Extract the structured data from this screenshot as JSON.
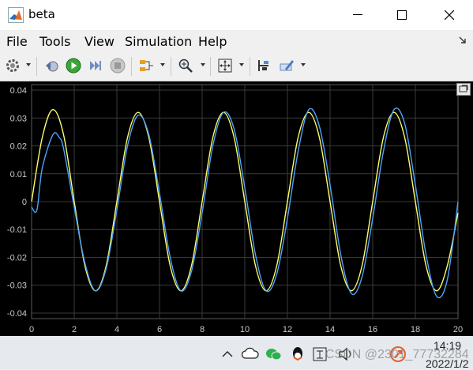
{
  "window": {
    "title": "beta"
  },
  "menu": [
    "File",
    "Tools",
    "View",
    "Simulation",
    "Help"
  ],
  "toolbar": {
    "icons": [
      "settings-gear-icon",
      "step-back-icon",
      "run-icon",
      "step-forward-icon",
      "stop-icon",
      "signal-select-icon",
      "zoom-icon",
      "fit-to-view-icon",
      "cursor-measure-icon",
      "highlight-pen-icon"
    ]
  },
  "colors": {
    "plot_bg": "#000000",
    "series_yellow": "#ffff66",
    "series_blue": "#4da3ff",
    "grid": "#3a3a3a",
    "tick_text": "#c8c8c8"
  },
  "chart_data": {
    "type": "line",
    "title": "",
    "xlabel": "",
    "ylabel": "",
    "xlim": [
      0,
      20
    ],
    "ylim": [
      -0.042,
      0.042
    ],
    "grid": true,
    "xticks": [
      "0",
      "2",
      "4",
      "6",
      "8",
      "10",
      "12",
      "14",
      "16",
      "18",
      "20"
    ],
    "yticks": [
      "0.04",
      "0.03",
      "0.02",
      "0.01",
      "0",
      "-0.01",
      "-0.02",
      "-0.03",
      "-0.04"
    ],
    "series": [
      {
        "color": "#ffff66",
        "x": [
          0,
          0.5,
          1,
          1.5,
          2,
          2.5,
          3,
          3.5,
          4,
          4.5,
          5,
          5.5,
          6,
          6.5,
          7,
          7.5,
          8,
          8.5,
          9,
          9.5,
          10,
          10.5,
          11,
          11.5,
          12,
          12.5,
          13,
          13.5,
          14,
          14.5,
          15,
          15.5,
          16,
          16.5,
          17,
          17.5,
          18,
          18.5,
          19,
          19.5,
          20
        ],
        "y": [
          0.0,
          0.023,
          0.033,
          0.024,
          0.0,
          -0.023,
          -0.032,
          -0.023,
          0.0,
          0.023,
          0.032,
          0.023,
          0.0,
          -0.023,
          -0.032,
          -0.023,
          0.0,
          0.023,
          0.032,
          0.023,
          0.0,
          -0.023,
          -0.032,
          -0.023,
          0.0,
          0.023,
          0.032,
          0.023,
          0.0,
          -0.023,
          -0.032,
          -0.023,
          0.0,
          0.023,
          0.032,
          0.023,
          0.0,
          -0.023,
          -0.032,
          -0.023,
          -0.004
        ]
      },
      {
        "color": "#4da3ff",
        "x": [
          0,
          0.25,
          0.5,
          1,
          1.3,
          1.5,
          2,
          2.5,
          3,
          3.5,
          4,
          4.5,
          5,
          5.5,
          6,
          6.5,
          7,
          7.5,
          8,
          8.5,
          9,
          9.5,
          10,
          10.5,
          11,
          11.5,
          12,
          12.5,
          13,
          13.5,
          14,
          14.5,
          15,
          15.5,
          16,
          16.5,
          17,
          17.5,
          18,
          18.5,
          19,
          19.5,
          20
        ],
        "y": [
          -0.002,
          -0.003,
          0.012,
          0.024,
          0.023,
          0.019,
          -0.002,
          -0.022,
          -0.032,
          -0.024,
          -0.003,
          0.02,
          0.031,
          0.024,
          0.003,
          -0.02,
          -0.032,
          -0.025,
          -0.004,
          0.02,
          0.032,
          0.026,
          0.005,
          -0.019,
          -0.032,
          -0.026,
          -0.006,
          0.018,
          0.033,
          0.027,
          0.006,
          -0.019,
          -0.033,
          -0.027,
          -0.006,
          0.018,
          0.033,
          0.028,
          0.006,
          -0.019,
          -0.034,
          -0.028,
          0.0
        ]
      }
    ]
  },
  "taskbar": {
    "time": "14:19",
    "date": "2022/1/2",
    "watermark": "CSDN @2301_77732284",
    "icons": [
      "chevron-up-icon",
      "cloud-icon",
      "wechat-icon",
      "qq-icon",
      "ime-icon",
      "speaker-icon",
      "app-tray-icon"
    ]
  }
}
